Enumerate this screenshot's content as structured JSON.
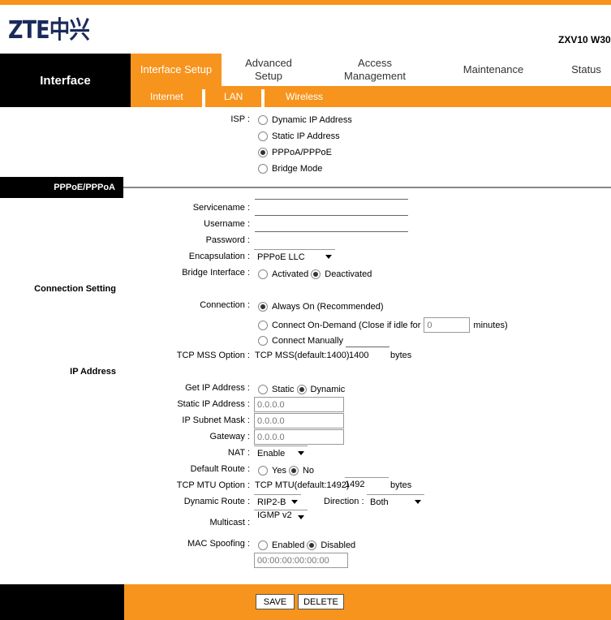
{
  "header": {
    "logo": "ZTE中兴",
    "model": "ZXV10 W30",
    "section": "Interface"
  },
  "nav": {
    "tabs": [
      "Interface Setup",
      "Advanced Setup",
      "Access Management",
      "Maintenance",
      "Status"
    ],
    "subtabs": [
      "Internet",
      "LAN",
      "Wireless"
    ]
  },
  "isp": {
    "label": "ISP :",
    "options": [
      "Dynamic IP Address",
      "Static IP Address",
      "PPPoA/PPPoE",
      "Bridge Mode"
    ],
    "selected": "PPPoA/PPPoE"
  },
  "section": {
    "title": "PPPoE/PPPoA",
    "connection_setting": "Connection Setting",
    "ip_address": "IP Address"
  },
  "form": {
    "servicename": {
      "label": "Servicename :",
      "value": ""
    },
    "username": {
      "label": "Username :",
      "value": ""
    },
    "password": {
      "label": "Password :",
      "value": ""
    },
    "encapsulation": {
      "label": "Encapsulation :",
      "value": "PPPoE LLC"
    },
    "bridge": {
      "label": "Bridge Interface :",
      "options": [
        "Activated",
        "Deactivated"
      ],
      "selected": "Deactivated"
    },
    "connection": {
      "label": "Connection :",
      "always": "Always On (Recommended)",
      "ondemand": "Connect On-Demand (Close if idle for",
      "idle_value": "0",
      "minutes": "minutes)",
      "manual": "Connect Manually",
      "selected": "Always On (Recommended)"
    },
    "tcp_mss": {
      "label": "TCP MSS Option :",
      "text": "TCP MSS(default:1400)",
      "value": "1400",
      "unit": "bytes"
    },
    "get_ip": {
      "label": "Get IP Address :",
      "options": [
        "Static",
        "Dynamic"
      ],
      "selected": "Dynamic"
    },
    "static_ip": {
      "label": "Static IP Address :",
      "value": "0.0.0.0"
    },
    "subnet": {
      "label": "IP Subnet Mask :",
      "value": "0.0.0.0"
    },
    "gateway": {
      "label": "Gateway :",
      "value": "0.0.0.0"
    },
    "nat": {
      "label": "NAT :",
      "value": "Enable"
    },
    "default_route": {
      "label": "Default Route :",
      "options": [
        "Yes",
        "No"
      ],
      "selected": "No"
    },
    "tcp_mtu": {
      "label": "TCP MTU Option :",
      "text": "TCP MTU(default:1492)",
      "value": "1492",
      "unit": "bytes"
    },
    "dynamic_route": {
      "label": "Dynamic Route :",
      "value": "RIP2-B",
      "direction_label": "Direction :",
      "direction": "Both"
    },
    "multicast": {
      "label": "Multicast :",
      "value": "IGMP v2"
    },
    "mac": {
      "label": "MAC Spoofing :",
      "options": [
        "Enabled",
        "Disabled"
      ],
      "selected": "Disabled",
      "value": "00:00:00:00:00:00"
    }
  },
  "buttons": {
    "save": "SAVE",
    "delete": "DELETE"
  },
  "colors": {
    "accent": "#f7941d",
    "dark": "#000000"
  }
}
